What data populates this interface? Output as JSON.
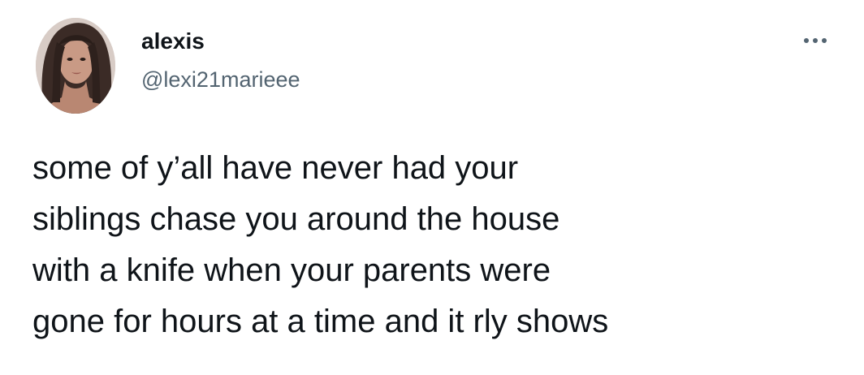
{
  "tweet": {
    "author": {
      "display_name": "alexis",
      "handle": "@lexi21marieee",
      "avatar_icon": "profile-photo"
    },
    "more_icon": "more-options-icon",
    "text_lines": [
      "some of y’all have never had your",
      "siblings chase you around the house",
      "with a knife when your parents were",
      "gone for hours at a time and it rly shows"
    ]
  },
  "colors": {
    "background": "#ffffff",
    "text_primary": "#0f1419",
    "text_secondary": "#536471"
  }
}
